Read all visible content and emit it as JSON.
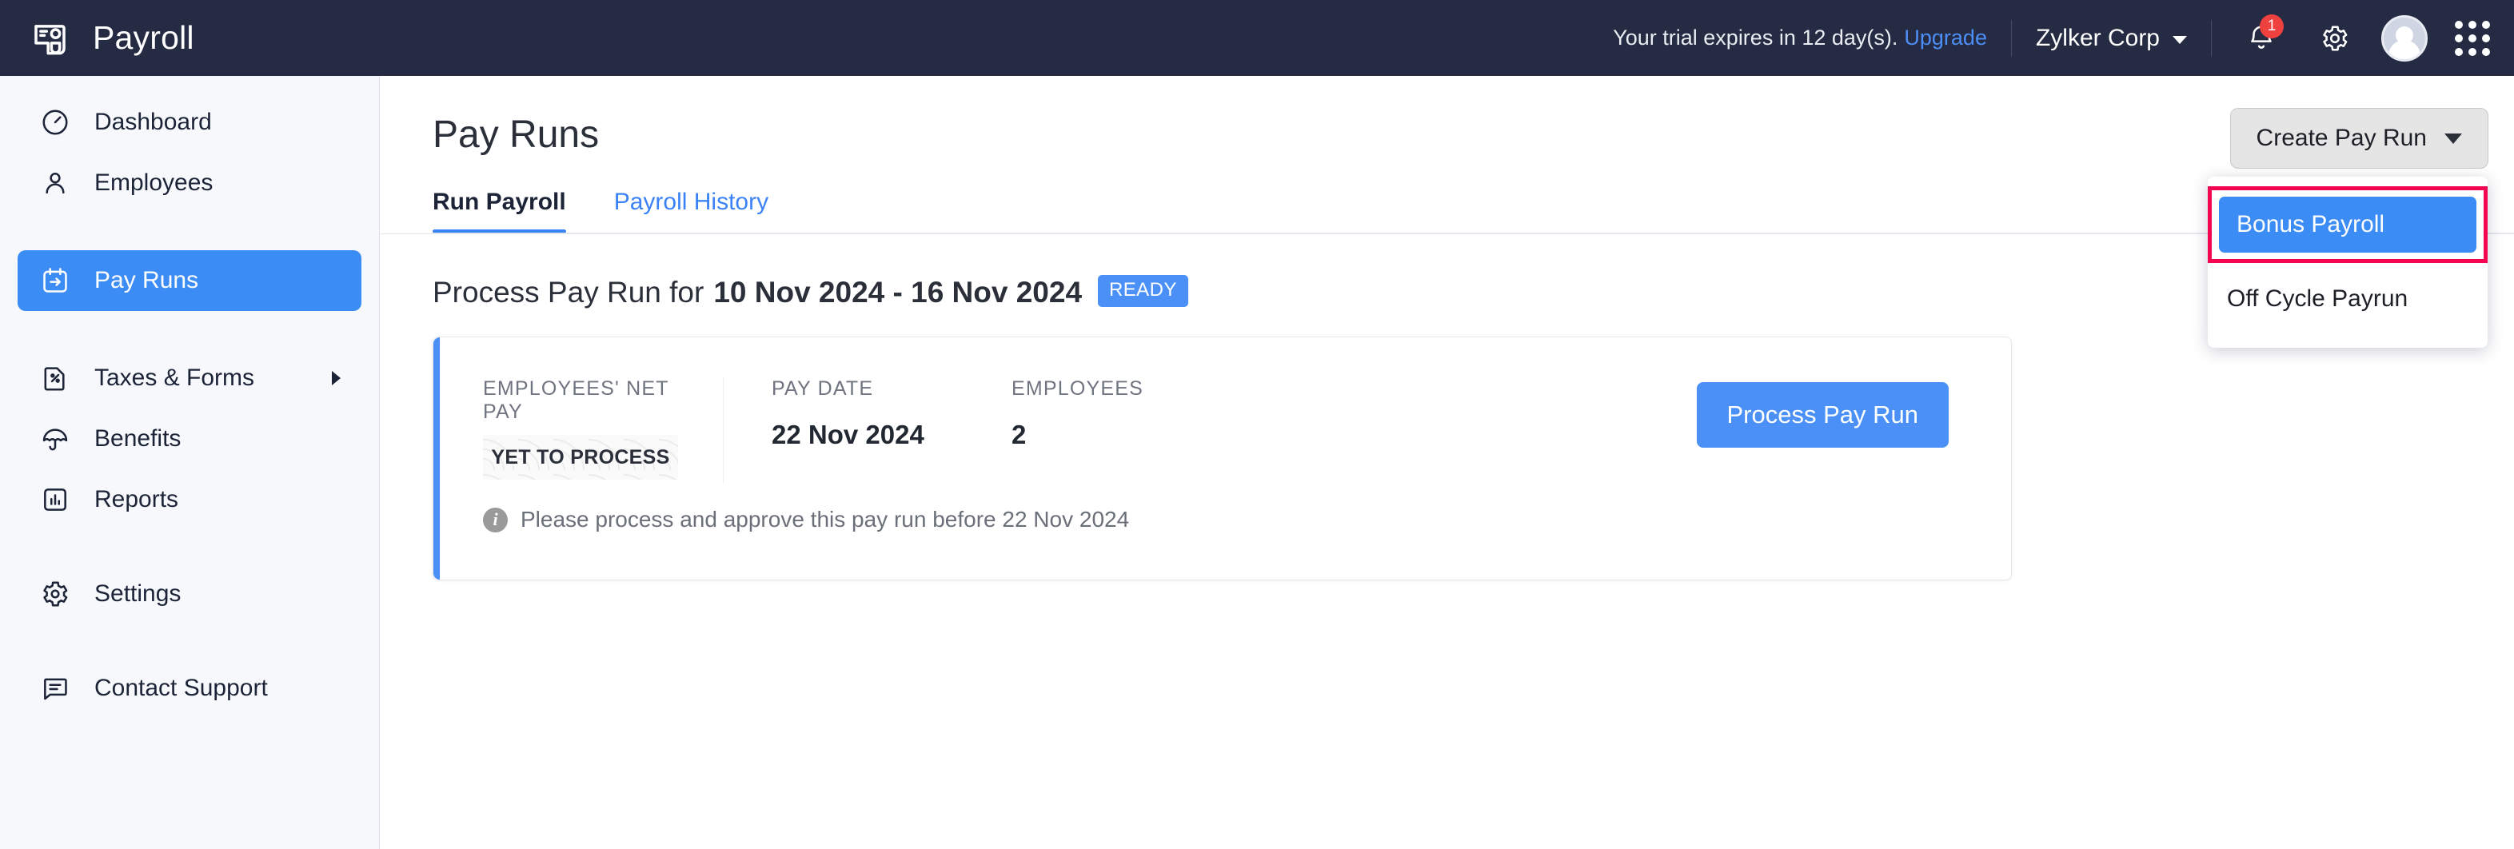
{
  "topbar": {
    "brand": "Payroll",
    "brand_icon": "payroll-card-icon",
    "trial_text": "Your trial expires in 12 day(s).",
    "upgrade_label": "Upgrade",
    "org_name": "Zylker Corp",
    "notification_count": "1",
    "notification_icon": "bell-icon",
    "settings_icon": "gear-icon",
    "avatar_icon": "user-avatar",
    "apps_icon": "app-grid-icon"
  },
  "sidebar": {
    "items": [
      {
        "label": "Dashboard",
        "icon": "clock-icon",
        "active": false
      },
      {
        "label": "Employees",
        "icon": "person-icon",
        "active": false
      },
      {
        "label": "Pay Runs",
        "icon": "calendar-arrow-icon",
        "active": true
      },
      {
        "label": "Taxes & Forms",
        "icon": "percent-document-icon",
        "active": false,
        "has_chevron": true
      },
      {
        "label": "Benefits",
        "icon": "umbrella-icon",
        "active": false
      },
      {
        "label": "Reports",
        "icon": "bar-chart-icon",
        "active": false
      },
      {
        "label": "Settings",
        "icon": "gear-icon",
        "active": false
      },
      {
        "label": "Contact Support",
        "icon": "chat-bubble-icon",
        "active": false
      }
    ]
  },
  "page": {
    "title": "Pay Runs",
    "tabs": [
      {
        "label": "Run Payroll",
        "active": true
      },
      {
        "label": "Payroll History",
        "active": false
      }
    ]
  },
  "create_pay_run": {
    "button_label": "Create Pay Run",
    "chevron_icon": "chevron-down-icon",
    "menu_items": [
      {
        "label": "Bonus Payroll",
        "selected": true,
        "highlighted": true
      },
      {
        "label": "Off Cycle Payrun",
        "selected": false,
        "highlighted": false
      }
    ]
  },
  "pay_run": {
    "heading_prefix": "Process Pay Run for",
    "period": "10 Nov 2024 - 16 Nov 2024",
    "status_badge": "READY",
    "stats": [
      {
        "label": "EMPLOYEES' NET PAY",
        "value": "YET TO PROCESS"
      },
      {
        "label": "PAY DATE",
        "value": "22 Nov 2024"
      },
      {
        "label": "EMPLOYEES",
        "value": "2"
      }
    ],
    "action_label": "Process Pay Run",
    "note_icon": "info-icon",
    "note": "Please process and approve this pay run before 22 Nov 2024"
  },
  "colors": {
    "accent_blue": "#3b8cf5",
    "topbar_dark": "#242b42",
    "sidebar_bg": "#f6f8fc",
    "highlight_pink": "#f5054f",
    "badge_red": "#f04141",
    "link_blue": "#4d8ef7"
  }
}
